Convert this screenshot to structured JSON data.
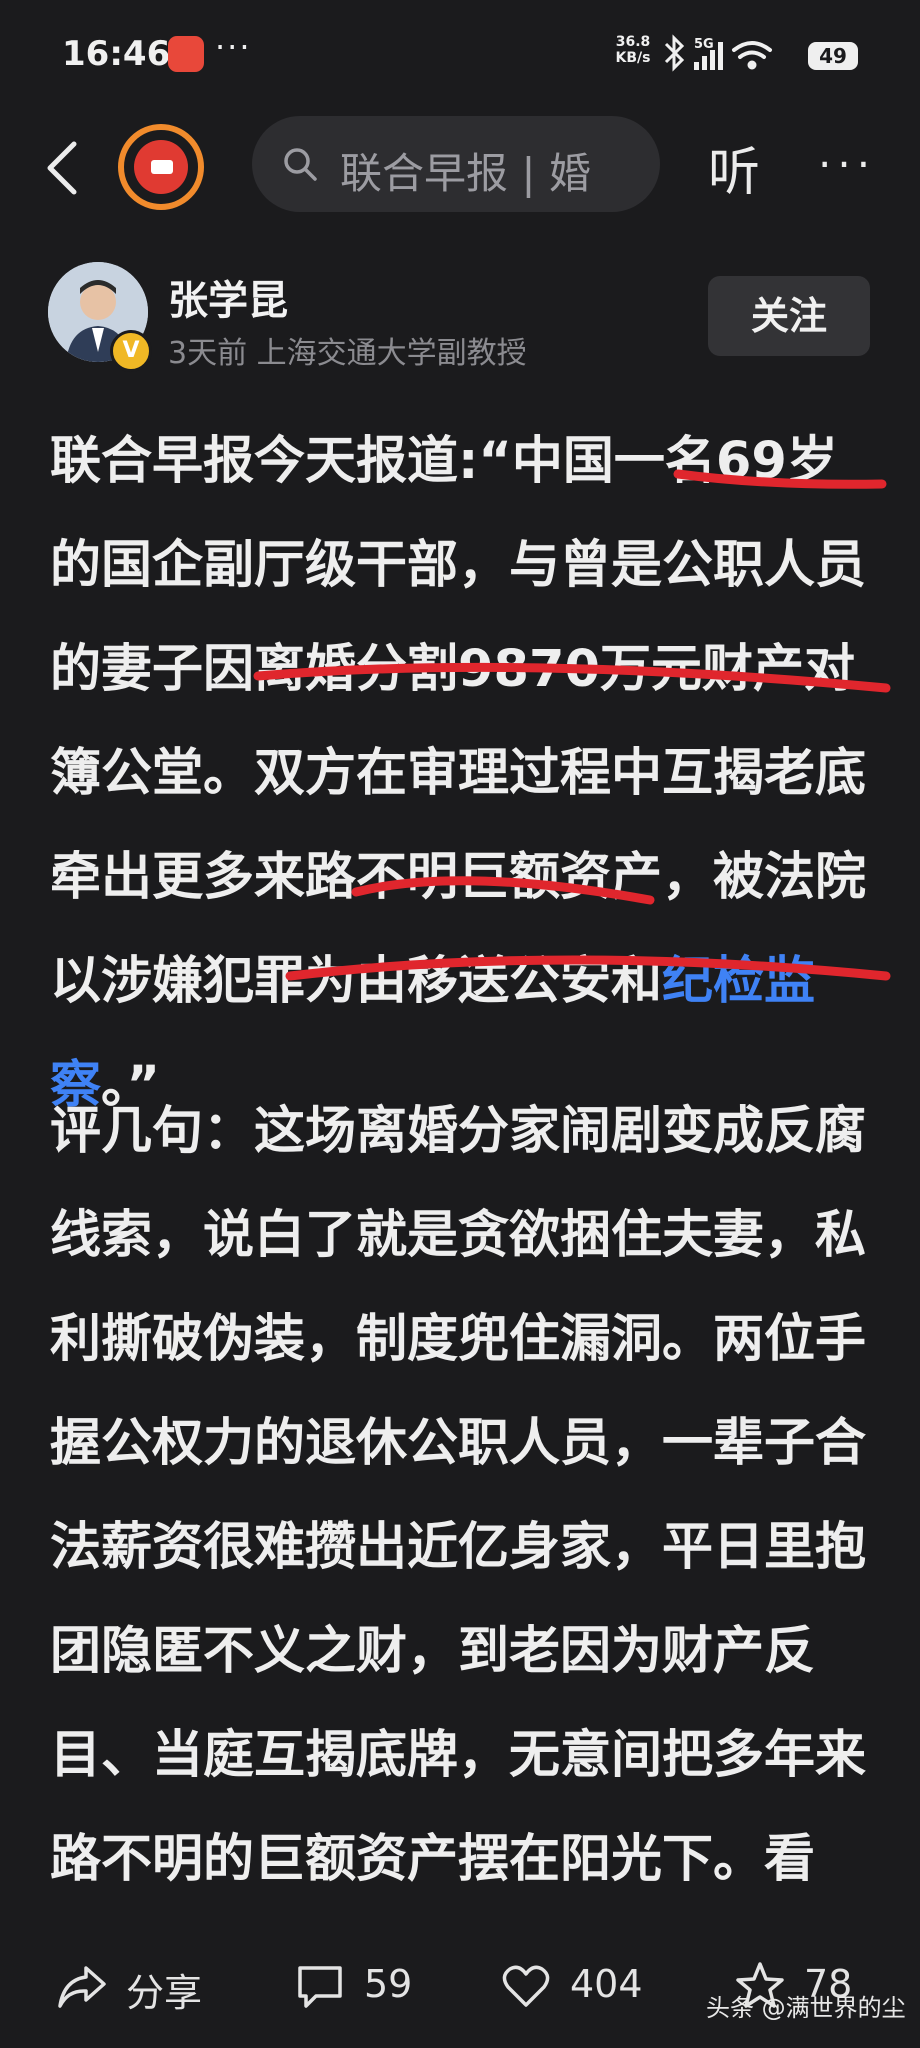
{
  "status_bar": {
    "time": "16:46",
    "dots": "···",
    "net_speed_value": "36.8",
    "net_speed_unit": "KB/s",
    "battery": "49"
  },
  "nav": {
    "search_text": "联合早报 | 婚",
    "listen_label": "听",
    "more_label": "···"
  },
  "author": {
    "name": "张学昆",
    "meta": "3天前  上海交通大学副教授",
    "badge": "V",
    "follow_label": "关注"
  },
  "article": {
    "p1_before_link": "联合早报今天报道:“中国一名69岁的国企副厅级干部，与曾是公职人员的妻子因离婚分割9870万元财产对簿公堂。双方在审理过程中互揭老底牵出更多来路不明巨额资产，被法院以涉嫌犯罪为由移送公安和",
    "p1_link": "纪检监察",
    "p1_after_link": "。”",
    "p2": "评几句：这场离婚分家闹剧变成反腐线索，说白了就是贪欲捆住夫妻，私利撕破伪装，制度兜住漏洞。两位手握公权力的退休公职人员，一辈子合法薪资很难攒出近亿身家，平日里抱团隐匿不义之财，到老因为财产反目、当庭互揭底牌，无意间把多年来路不明的巨额资产摆在阳光下。看"
  },
  "actions": {
    "share_label": "分享",
    "comments_count": "59",
    "likes_count": "404",
    "favorites_count": "78",
    "watermark": "头条 @满世界的尘"
  },
  "colors": {
    "background": "#1b1b1d",
    "link": "#3f82f5",
    "annotation_red": "#e0262d",
    "avatar_ring": "#f18b2c"
  }
}
